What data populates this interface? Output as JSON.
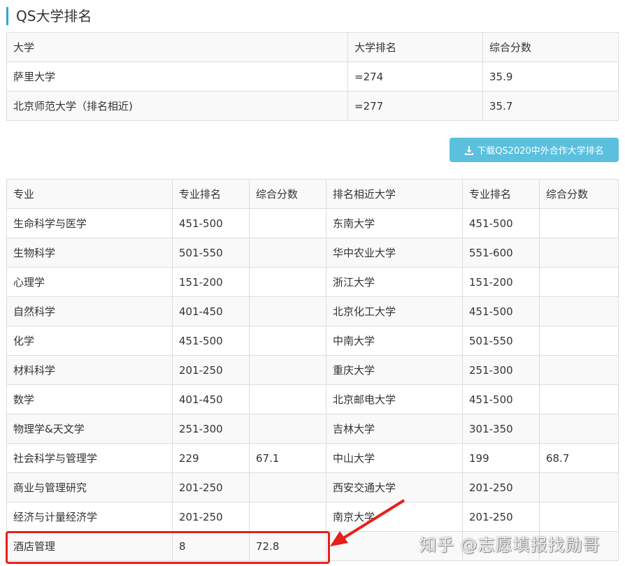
{
  "title": "QS大学排名",
  "uni_table": {
    "headers": [
      "大学",
      "大学排名",
      "综合分数"
    ],
    "rows": [
      [
        "萨里大学",
        "=274",
        "35.9"
      ],
      [
        "北京师范大学（排名相近)",
        "=277",
        "35.7"
      ]
    ]
  },
  "download_button": "下载QS2020中外合作大学排名",
  "subject_table": {
    "headers": [
      "专业",
      "专业排名",
      "综合分数",
      "排名相近大学",
      "专业排名",
      "综合分数"
    ],
    "rows": [
      [
        "生命科学与医学",
        "451-500",
        "",
        "东南大学",
        "451-500",
        ""
      ],
      [
        "生物科学",
        "501-550",
        "",
        "华中农业大学",
        "551-600",
        ""
      ],
      [
        "心理学",
        "151-200",
        "",
        "浙江大学",
        "151-200",
        ""
      ],
      [
        "自然科学",
        "401-450",
        "",
        "北京化工大学",
        "451-500",
        ""
      ],
      [
        "化学",
        "451-500",
        "",
        "中南大学",
        "501-550",
        ""
      ],
      [
        "材料科学",
        "201-250",
        "",
        "重庆大学",
        "251-300",
        ""
      ],
      [
        "数学",
        "401-450",
        "",
        "北京邮电大学",
        "451-500",
        ""
      ],
      [
        "物理学&天文学",
        "251-300",
        "",
        "吉林大学",
        "301-350",
        ""
      ],
      [
        "社会科学与管理学",
        "229",
        "67.1",
        "中山大学",
        "199",
        "68.7"
      ],
      [
        "商业与管理研究",
        "201-250",
        "",
        "西安交通大学",
        "201-250",
        ""
      ],
      [
        "经济与计量经济学",
        "201-250",
        "",
        "南京大学",
        "201-250",
        ""
      ],
      [
        "酒店管理",
        "8",
        "72.8",
        "",
        "",
        ""
      ]
    ]
  },
  "watermark": "知乎 @志愿填报找勋哥",
  "colors": {
    "accent": "#29a8d8",
    "button": "#5bc0de",
    "highlight": "#e8201a"
  }
}
